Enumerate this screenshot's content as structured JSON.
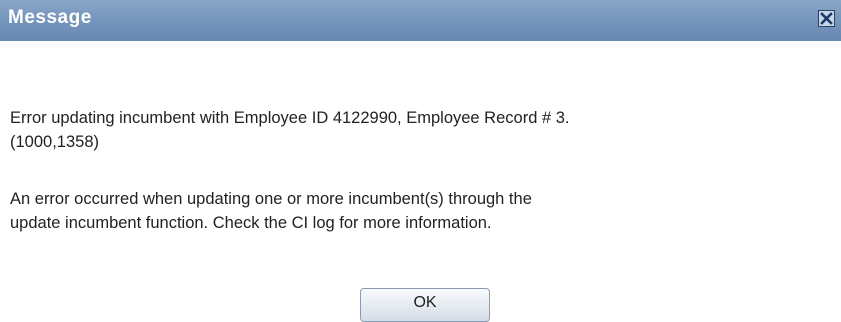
{
  "dialog": {
    "title": "Message",
    "close_icon": "close-x-icon",
    "message_line_1": "Error updating incumbent with Employee ID 4122990, Employee Record # 3.",
    "message_line_2": "(1000,1358)",
    "message_line_3": "An error occurred when updating one or more incumbent(s) through the",
    "message_line_4": "update incumbent function. Check the CI log for more information.",
    "ok_label": "OK"
  },
  "colors": {
    "titlebar": "#7595bc",
    "title_text": "#ffffff",
    "body_text": "#222222",
    "close_border": "#2b4466"
  }
}
